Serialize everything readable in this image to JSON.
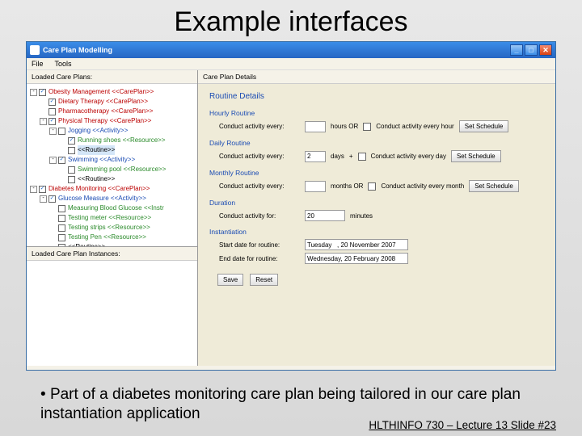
{
  "slide": {
    "title": "Example interfaces",
    "bullet": "Part of a diabetes monitoring care plan being tailored in our care plan instantiation application",
    "footer": "HLTHINFO 730 – Lecture 13 Slide #23"
  },
  "window": {
    "title": "Care Plan Modelling",
    "menu": {
      "file": "File",
      "tools": "Tools"
    },
    "controls": {
      "min": "_",
      "max": "□",
      "close": "✕"
    }
  },
  "left": {
    "header1": "Loaded Care Plans:",
    "header2": "Loaded Care Plan Instances:",
    "tree": [
      {
        "indent": 0,
        "toggle": "-",
        "checked": true,
        "color": "tl-red",
        "text": "Obesity Management <<CarePlan>>"
      },
      {
        "indent": 1,
        "toggle": "",
        "checked": true,
        "color": "tl-red",
        "text": "Dietary Therapy <<CarePlan>>"
      },
      {
        "indent": 1,
        "toggle": "",
        "checked": false,
        "color": "tl-red",
        "text": "Pharmacotherapy <<CarePlan>>"
      },
      {
        "indent": 1,
        "toggle": "-",
        "checked": true,
        "color": "tl-red",
        "text": "Physical Therapy <<CarePlan>>"
      },
      {
        "indent": 2,
        "toggle": "-",
        "checked": false,
        "color": "tl-blue",
        "text": "Jogging <<Activity>>"
      },
      {
        "indent": 3,
        "toggle": "",
        "checked": true,
        "color": "tl-green",
        "text": "Running shoes <<Resource>>"
      },
      {
        "indent": 3,
        "toggle": "",
        "checked": false,
        "color": "tl-black",
        "text": "<<Routine>>",
        "sel": true
      },
      {
        "indent": 2,
        "toggle": "-",
        "checked": true,
        "color": "tl-blue",
        "text": "Swimming <<Activity>>"
      },
      {
        "indent": 3,
        "toggle": "",
        "checked": false,
        "color": "tl-green",
        "text": "Swimming pool <<Resource>>"
      },
      {
        "indent": 3,
        "toggle": "",
        "checked": false,
        "color": "tl-black",
        "text": "<<Routine>>"
      },
      {
        "indent": 0,
        "toggle": "-",
        "checked": true,
        "color": "tl-red",
        "text": "Diabetes Monitoring <<CarePlan>>"
      },
      {
        "indent": 1,
        "toggle": "-",
        "checked": true,
        "color": "tl-blue",
        "text": "Glucose Measure <<Activity>>"
      },
      {
        "indent": 2,
        "toggle": "",
        "checked": false,
        "color": "tl-green",
        "text": "Measuring Blood Glucose <<Instr"
      },
      {
        "indent": 2,
        "toggle": "",
        "checked": false,
        "color": "tl-green",
        "text": "Testing meter <<Resource>>"
      },
      {
        "indent": 2,
        "toggle": "",
        "checked": false,
        "color": "tl-green",
        "text": "Testing strips <<Resource>>"
      },
      {
        "indent": 2,
        "toggle": "",
        "checked": false,
        "color": "tl-green",
        "text": "Testing Pen <<Resource>>"
      },
      {
        "indent": 2,
        "toggle": "",
        "checked": false,
        "color": "tl-black",
        "text": "<<Routine>>"
      }
    ]
  },
  "right": {
    "header": "Care Plan Details",
    "title": "Routine Details",
    "groups": {
      "hourly": "Hourly Routine",
      "daily": "Daily Routine",
      "monthly": "Monthly Routine",
      "duration": "Duration",
      "instant": "Instantiation"
    },
    "rows": {
      "hourly_lbl": "Conduct activity every:",
      "hourly_unit": "hours OR",
      "hourly_chk": "Conduct activity every hour",
      "daily_lbl": "Conduct activity every:",
      "daily_val": "2",
      "daily_unit": "days",
      "daily_sep": "+",
      "daily_chk": "Conduct activity every day",
      "monthly_lbl": "Conduct activity every:",
      "monthly_unit": "months OR",
      "monthly_chk": "Conduct activity every month",
      "duration_lbl": "Conduct activity for:",
      "duration_val": "20",
      "duration_unit": "minutes",
      "start_lbl": "Start date for routine:",
      "start_val": "Tuesday   , 20 November 2007",
      "end_lbl": "End date for routine:",
      "end_val": "Wednesday, 20 February 2008"
    },
    "buttons": {
      "set_schedule": "Set Schedule",
      "save": "Save",
      "reset": "Reset"
    }
  }
}
